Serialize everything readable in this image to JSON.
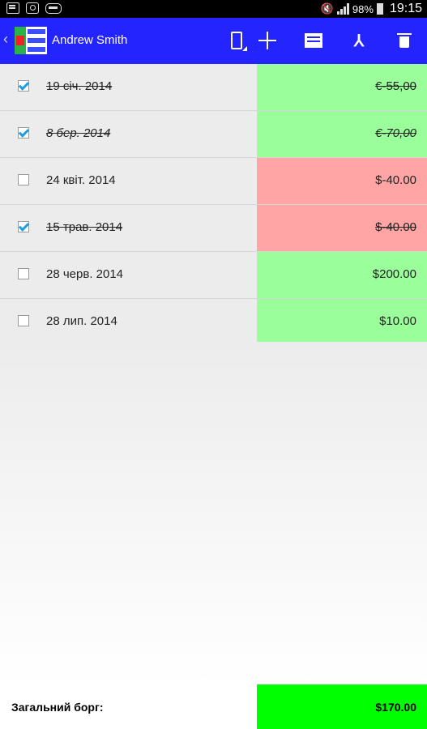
{
  "status_bar": {
    "battery": "98%",
    "time": "19:15"
  },
  "action_bar": {
    "title": "Andrew Smith",
    "icons": [
      "back-icon",
      "app-logo-icon",
      "phone-icon",
      "add-icon",
      "card-icon",
      "split-icon",
      "trash-icon"
    ]
  },
  "rows": [
    {
      "date": "19 січ. 2014",
      "amount": "€-55,00",
      "checked": true,
      "strike": true,
      "italic": false,
      "color": "#9aff9a"
    },
    {
      "date": "8 бер. 2014",
      "amount": "€-70,00",
      "checked": true,
      "strike": true,
      "italic": true,
      "color": "#9aff9a"
    },
    {
      "date": "24 квіт. 2014",
      "amount": "$-40.00",
      "checked": false,
      "strike": false,
      "italic": false,
      "color": "#ffa5a5"
    },
    {
      "date": "15 трав. 2014",
      "amount": "$-40.00",
      "checked": true,
      "strike": true,
      "italic": false,
      "color": "#ffa5a5"
    },
    {
      "date": "28 черв. 2014",
      "amount": "$200.00",
      "checked": false,
      "strike": false,
      "italic": false,
      "color": "#9aff9a"
    },
    {
      "date": "28 лип. 2014",
      "amount": "$10.00",
      "checked": false,
      "strike": false,
      "italic": false,
      "color": "#9aff9a"
    }
  ],
  "footer": {
    "label": "Загальний борг:",
    "total": "$170.00",
    "color": "#00ff00"
  }
}
